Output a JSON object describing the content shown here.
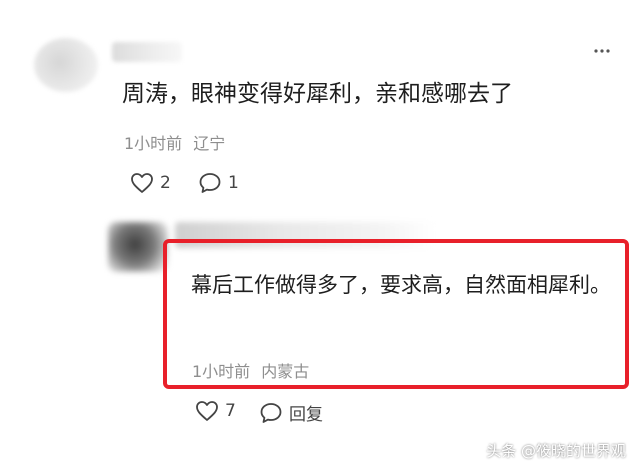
{
  "comment": {
    "text": "周涛，眼神变得好犀利，亲和感哪去了",
    "time": "1小时前",
    "location": "辽宁",
    "likes": "2",
    "replies": "1"
  },
  "reply": {
    "text": "幕后工作做得多了，要求高，自然面相犀利。",
    "time": "1小时前",
    "location": "内蒙古",
    "likes": "7",
    "reply_label": "回复"
  },
  "watermark": "头条 @筱晓的世界观",
  "colors": {
    "highlight_border": "#e8202a",
    "meta_text": "#8e8e8e",
    "body_text": "#1e1e1e"
  }
}
